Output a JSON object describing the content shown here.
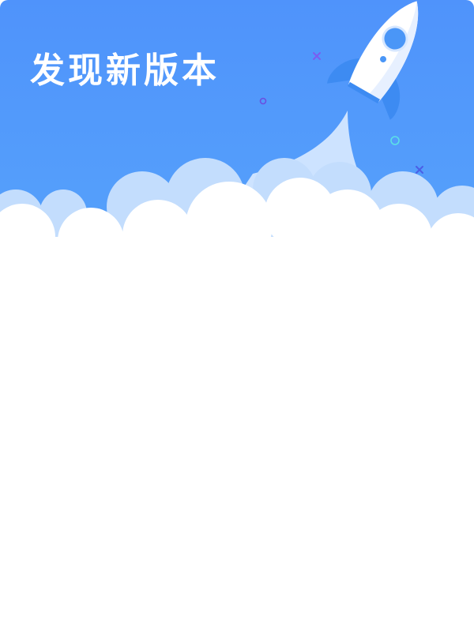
{
  "dialog": {
    "title": "发现新版本"
  },
  "colors": {
    "header_blue": "#4f93fb",
    "cloud_light": "#c3ddfd",
    "cloud_white": "#ffffff",
    "rocket_body": "#ffffff",
    "rocket_accent": "#3d8bf2"
  },
  "decorations": {
    "icons": [
      "rocket-icon",
      "sparkle-x-icon",
      "ring-icon",
      "cloud-icon"
    ]
  }
}
